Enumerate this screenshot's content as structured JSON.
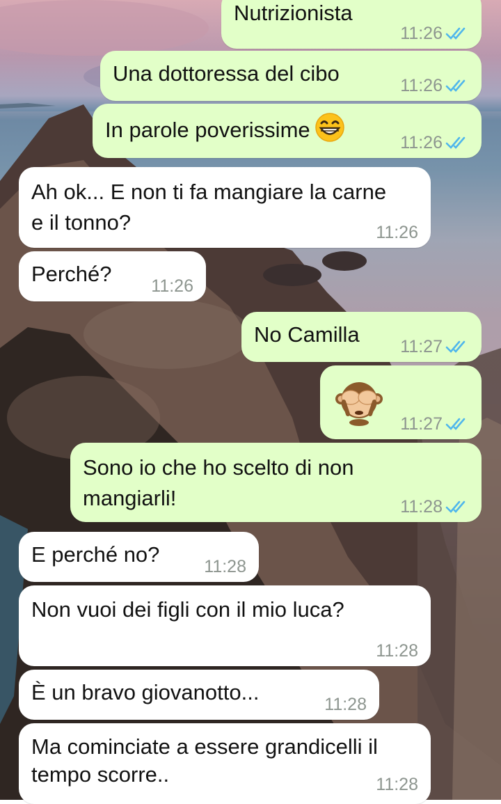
{
  "chat": {
    "messages": [
      {
        "id": "m1",
        "direction": "out",
        "text": "Nutrizionista",
        "time": "11:26",
        "status": "read"
      },
      {
        "id": "m2",
        "direction": "out",
        "text": "Una dottoressa del cibo",
        "time": "11:26",
        "status": "read"
      },
      {
        "id": "m3",
        "direction": "out",
        "text": "In parole poverissime",
        "emoji": "grinning-face",
        "time": "11:26",
        "status": "read"
      },
      {
        "id": "m4",
        "direction": "in",
        "text": "Ah ok... E non ti fa mangiare la carne e il tonno?",
        "time": "11:26"
      },
      {
        "id": "m5",
        "direction": "in",
        "text": "Perché?",
        "time": "11:26"
      },
      {
        "id": "m6",
        "direction": "out",
        "text": "No Camilla",
        "time": "11:27",
        "status": "read"
      },
      {
        "id": "m7",
        "direction": "out",
        "emoji": "see-no-evil-monkey",
        "time": "11:27",
        "status": "read"
      },
      {
        "id": "m8",
        "direction": "out",
        "text": "Sono io che ho scelto di non mangiarli!",
        "time": "11:28",
        "status": "read"
      },
      {
        "id": "m9",
        "direction": "in",
        "text": "E perché no?",
        "time": "11:28"
      },
      {
        "id": "m10",
        "direction": "in",
        "text": "Non vuoi dei figli con il mio luca?",
        "time": "11:28"
      },
      {
        "id": "m11",
        "direction": "in",
        "text": "È un bravo giovanotto...",
        "time": "11:28"
      },
      {
        "id": "m12",
        "direction": "in",
        "text": "Ma cominciate a essere grandicelli il tempo scorre..",
        "time": "11:28"
      }
    ]
  },
  "colors": {
    "outgoing_bubble": "#e2ffc8",
    "incoming_bubble": "#ffffff",
    "read_ticks": "#4fb6ec",
    "timestamp": "#8d958f"
  },
  "icons": {
    "read_receipt": "double-check-icon"
  }
}
